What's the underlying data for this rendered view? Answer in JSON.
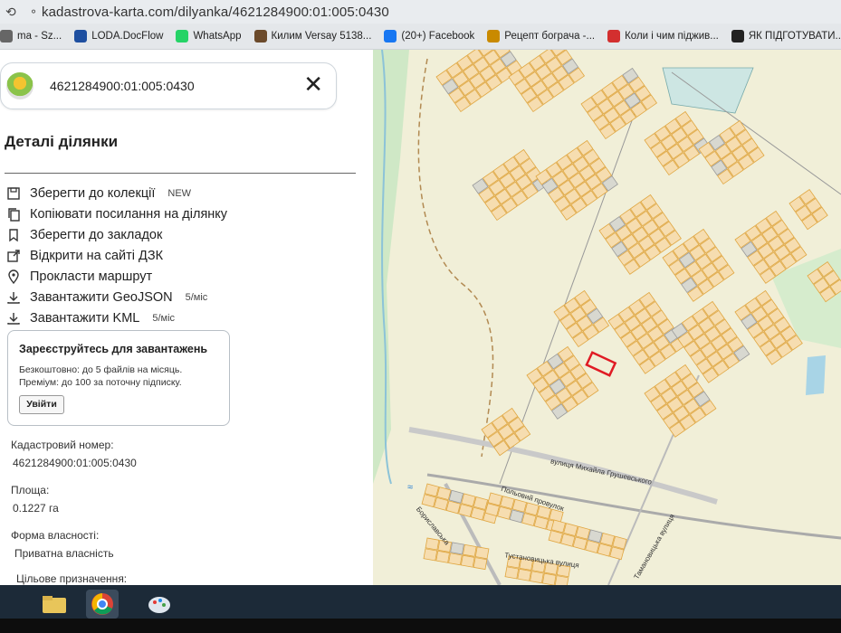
{
  "browser": {
    "url": "kadastrova-karta.com/dilyanka/4621284900:01:005:0430",
    "bookmarks": [
      {
        "label": "ma - Sz...",
        "color": "#666666"
      },
      {
        "label": "LODA.DocFlow",
        "color": "#1e4fa0"
      },
      {
        "label": "WhatsApp",
        "color": "#25d366"
      },
      {
        "label": "Килим Versay 5138...",
        "color": "#6b4a2b"
      },
      {
        "label": "(20+) Facebook",
        "color": "#1877f2"
      },
      {
        "label": "Рецепт бограча -...",
        "color": "#c98a00"
      },
      {
        "label": "Коли і чим піджив...",
        "color": "#d32f2f"
      },
      {
        "label": "ЯК ПІДГОТУВАТИ...",
        "color": "#222222"
      }
    ]
  },
  "search": {
    "value": "4621284900:01:005:0430"
  },
  "details": {
    "title": "Деталі ділянки",
    "actions": [
      {
        "label": "Зберегти до колекції",
        "badge": "NEW",
        "icon": "save-icon"
      },
      {
        "label": "Копіювати посилання на ділянку",
        "badge": "",
        "icon": "copy-icon"
      },
      {
        "label": "Зберегти до закладок",
        "badge": "",
        "icon": "bookmark-icon"
      },
      {
        "label": "Відкрити на сайті ДЗК",
        "badge": "",
        "icon": "external-link-icon"
      },
      {
        "label": "Прокласти маршрут",
        "badge": "",
        "icon": "location-pin-icon"
      },
      {
        "label": "Завантажити GeoJSON",
        "badge": "5/міс",
        "icon": "download-icon"
      },
      {
        "label": "Завантажити KML",
        "badge": "5/міс",
        "icon": "download-icon"
      }
    ],
    "register": {
      "title": "Зареєструйтесь для завантажень",
      "line1": "Безкоштовно: до 5 файлів на місяць.",
      "line2": "Преміум: до 100 за поточну підписку.",
      "login": "Увійти"
    },
    "cadastral_label": "Кадастровий номер:",
    "cadastral_value": "4621284900:01:005:0430",
    "area_label": "Площа:",
    "area_value": "0.1227 га",
    "ownership_label": "Форма власності:",
    "ownership_value": "Приватна власність",
    "purpose_label": "Цільове призначення:"
  },
  "map": {
    "streets": [
      "вулиця Михайла Грушевського",
      "Польовий провулок",
      "Бориславська",
      "Тустановицька вулиця",
      "Тамановицька вулиця",
      "Бориславська"
    ],
    "colors": {
      "background": "#f1efd8",
      "parcel": "#f6ddb0",
      "parcel_border": "#e0a640",
      "selected": "#e01b24",
      "forest": "#cfe8c6",
      "water": "#a8d4e6"
    }
  }
}
